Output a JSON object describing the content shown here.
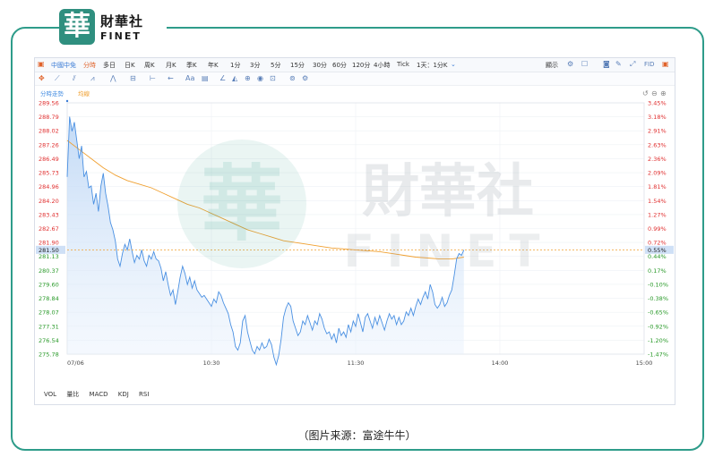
{
  "brand": {
    "cn": "財華社",
    "en": "FINET",
    "mark": "華"
  },
  "toolbar": {
    "symbol": "中國中免",
    "periods": [
      "分時",
      "多日",
      "日K",
      "周K",
      "月K",
      "季K",
      "年K",
      "1分",
      "3分",
      "5分",
      "15分",
      "30分",
      "60分",
      "120分",
      "4小時",
      "Tick",
      "1天：1分K"
    ],
    "right": {
      "display": "顯示",
      "fid": "FID"
    }
  },
  "legend": {
    "series1": "分時走勢",
    "series2": "均線"
  },
  "indicators": [
    "VOL",
    "量比",
    "MACD",
    "KDJ",
    "RSI"
  ],
  "caption": "（图片来源：富途牛牛）",
  "watermark": {
    "cn": "財華社",
    "en": "FINET"
  },
  "colors": {
    "price": "#4a90e2",
    "avg": "#f0a030",
    "up": "#e03030",
    "down": "#2a9a2a",
    "accent": "#2e9c8a"
  },
  "chart_data": {
    "type": "line",
    "x_ticks": [
      "07/06",
      "10:30",
      "11:30",
      "14:00",
      "15:00"
    ],
    "y_left_ticks": [
      "289.56",
      "288.79",
      "288.02",
      "287.26",
      "286.49",
      "285.73",
      "284.96",
      "284.20",
      "283.43",
      "282.67",
      "281.90",
      "281.13",
      "280.37",
      "279.60",
      "278.84",
      "278.07",
      "277.31",
      "276.54",
      "275.78"
    ],
    "y_right_ticks": [
      "3.45%",
      "3.18%",
      "2.91%",
      "2.63%",
      "2.36%",
      "2.09%",
      "1.81%",
      "1.54%",
      "1.27%",
      "0.99%",
      "0.72%",
      "0.44%",
      "0.17%",
      "-0.10%",
      "-0.38%",
      "-0.65%",
      "-0.92%",
      "-1.20%",
      "-1.47%"
    ],
    "prev_close": 281.5,
    "current_price_label": "281.50",
    "current_pct_label": "0.55%",
    "ylim": [
      275.78,
      289.56
    ],
    "xlim": [
      0,
      240
    ],
    "series": [
      {
        "name": "分時走勢",
        "values": [
          [
            0,
            285.5
          ],
          [
            1,
            288.8
          ],
          [
            2,
            288.0
          ],
          [
            3,
            288.5
          ],
          [
            4,
            287.5
          ],
          [
            5,
            286.5
          ],
          [
            6,
            287.2
          ],
          [
            7,
            285.5
          ],
          [
            8,
            285.8
          ],
          [
            9,
            284.9
          ],
          [
            10,
            285.0
          ],
          [
            11,
            284.0
          ],
          [
            12,
            284.6
          ],
          [
            13,
            283.6
          ],
          [
            14,
            285.0
          ],
          [
            15,
            285.7
          ],
          [
            16,
            284.6
          ],
          [
            17,
            283.9
          ],
          [
            18,
            283.0
          ],
          [
            19,
            282.6
          ],
          [
            20,
            282.0
          ],
          [
            21,
            281.0
          ],
          [
            22,
            280.6
          ],
          [
            23,
            281.3
          ],
          [
            24,
            281.8
          ],
          [
            25,
            281.5
          ],
          [
            26,
            282.1
          ],
          [
            27,
            281.4
          ],
          [
            28,
            280.8
          ],
          [
            29,
            281.2
          ],
          [
            30,
            281.0
          ],
          [
            31,
            281.5
          ],
          [
            32,
            280.9
          ],
          [
            33,
            280.6
          ],
          [
            34,
            281.2
          ],
          [
            35,
            281.0
          ],
          [
            36,
            281.4
          ],
          [
            37,
            281.0
          ],
          [
            38,
            280.9
          ],
          [
            39,
            280.5
          ],
          [
            40,
            279.8
          ],
          [
            41,
            280.3
          ],
          [
            42,
            279.6
          ],
          [
            43,
            279.0
          ],
          [
            44,
            279.3
          ],
          [
            45,
            278.5
          ],
          [
            46,
            279.2
          ],
          [
            47,
            280.0
          ],
          [
            48,
            280.6
          ],
          [
            49,
            280.2
          ],
          [
            50,
            279.6
          ],
          [
            51,
            280.0
          ],
          [
            52,
            279.4
          ],
          [
            53,
            279.8
          ],
          [
            54,
            279.3
          ],
          [
            55,
            279.1
          ],
          [
            56,
            278.9
          ],
          [
            57,
            279.0
          ],
          [
            58,
            278.8
          ],
          [
            59,
            278.6
          ],
          [
            60,
            278.4
          ],
          [
            61,
            278.8
          ],
          [
            62,
            278.6
          ],
          [
            63,
            279.2
          ],
          [
            64,
            279.0
          ],
          [
            65,
            278.6
          ],
          [
            66,
            278.3
          ],
          [
            67,
            278.0
          ],
          [
            68,
            277.4
          ],
          [
            69,
            277.0
          ],
          [
            70,
            276.2
          ],
          [
            71,
            276.0
          ],
          [
            72,
            276.4
          ],
          [
            73,
            277.6
          ],
          [
            74,
            277.9
          ],
          [
            75,
            277.0
          ],
          [
            76,
            276.5
          ],
          [
            77,
            276.0
          ],
          [
            78,
            275.8
          ],
          [
            79,
            276.2
          ],
          [
            80,
            276.0
          ],
          [
            81,
            276.4
          ],
          [
            82,
            276.1
          ],
          [
            83,
            276.2
          ],
          [
            84,
            276.6
          ],
          [
            85,
            276.3
          ],
          [
            86,
            275.6
          ],
          [
            87,
            275.2
          ],
          [
            88,
            275.7
          ],
          [
            89,
            276.6
          ],
          [
            90,
            277.8
          ],
          [
            91,
            278.3
          ],
          [
            92,
            278.6
          ],
          [
            93,
            278.4
          ],
          [
            94,
            277.6
          ],
          [
            95,
            277.2
          ],
          [
            96,
            276.8
          ],
          [
            97,
            277.0
          ],
          [
            98,
            277.6
          ],
          [
            99,
            277.4
          ],
          [
            100,
            277.9
          ],
          [
            101,
            277.5
          ],
          [
            102,
            277.1
          ],
          [
            103,
            277.6
          ],
          [
            104,
            277.4
          ],
          [
            105,
            278.0
          ],
          [
            106,
            277.7
          ],
          [
            107,
            277.2
          ],
          [
            108,
            276.9
          ],
          [
            109,
            277.0
          ],
          [
            110,
            276.6
          ],
          [
            111,
            276.9
          ],
          [
            112,
            276.4
          ],
          [
            113,
            277.2
          ],
          [
            114,
            276.8
          ],
          [
            115,
            277.0
          ],
          [
            116,
            276.7
          ],
          [
            117,
            277.4
          ],
          [
            118,
            277.0
          ],
          [
            119,
            277.6
          ],
          [
            120,
            277.3
          ],
          [
            121,
            278.0
          ],
          [
            122,
            277.5
          ],
          [
            123,
            277.0
          ],
          [
            124,
            277.8
          ],
          [
            125,
            278.0
          ],
          [
            126,
            277.6
          ],
          [
            127,
            277.2
          ],
          [
            128,
            277.8
          ],
          [
            129,
            277.4
          ],
          [
            130,
            277.9
          ],
          [
            131,
            277.5
          ],
          [
            132,
            277.1
          ],
          [
            133,
            277.6
          ],
          [
            134,
            278.0
          ],
          [
            135,
            277.7
          ],
          [
            136,
            277.9
          ],
          [
            137,
            277.4
          ],
          [
            138,
            277.8
          ],
          [
            139,
            277.4
          ],
          [
            140,
            277.6
          ],
          [
            141,
            278.1
          ],
          [
            142,
            277.9
          ],
          [
            143,
            278.3
          ],
          [
            144,
            277.9
          ],
          [
            145,
            278.4
          ],
          [
            146,
            278.8
          ],
          [
            147,
            278.5
          ],
          [
            148,
            278.9
          ],
          [
            149,
            279.2
          ],
          [
            150,
            278.8
          ],
          [
            151,
            279.6
          ],
          [
            152,
            279.2
          ],
          [
            153,
            278.5
          ],
          [
            154,
            278.3
          ],
          [
            155,
            278.5
          ],
          [
            156,
            278.9
          ],
          [
            157,
            278.4
          ],
          [
            158,
            278.6
          ],
          [
            159,
            279.0
          ],
          [
            160,
            279.3
          ],
          [
            161,
            280.1
          ],
          [
            162,
            281.0
          ],
          [
            163,
            281.3
          ],
          [
            164,
            281.2
          ],
          [
            165,
            281.5
          ]
        ]
      },
      {
        "name": "均線",
        "values": [
          [
            0,
            287.5
          ],
          [
            5,
            287.0
          ],
          [
            10,
            286.5
          ],
          [
            15,
            286.0
          ],
          [
            20,
            285.6
          ],
          [
            25,
            285.3
          ],
          [
            30,
            285.1
          ],
          [
            35,
            284.9
          ],
          [
            40,
            284.6
          ],
          [
            45,
            284.3
          ],
          [
            50,
            284.0
          ],
          [
            55,
            283.8
          ],
          [
            60,
            283.5
          ],
          [
            65,
            283.2
          ],
          [
            70,
            282.9
          ],
          [
            75,
            282.6
          ],
          [
            80,
            282.4
          ],
          [
            85,
            282.2
          ],
          [
            90,
            282.0
          ],
          [
            95,
            281.9
          ],
          [
            100,
            281.8
          ],
          [
            105,
            281.7
          ],
          [
            110,
            281.6
          ],
          [
            115,
            281.55
          ],
          [
            120,
            281.5
          ],
          [
            125,
            281.45
          ],
          [
            130,
            281.4
          ],
          [
            135,
            281.3
          ],
          [
            140,
            281.2
          ],
          [
            145,
            281.1
          ],
          [
            150,
            281.05
          ],
          [
            155,
            281.0
          ],
          [
            160,
            281.0
          ],
          [
            165,
            281.1
          ]
        ]
      }
    ]
  }
}
